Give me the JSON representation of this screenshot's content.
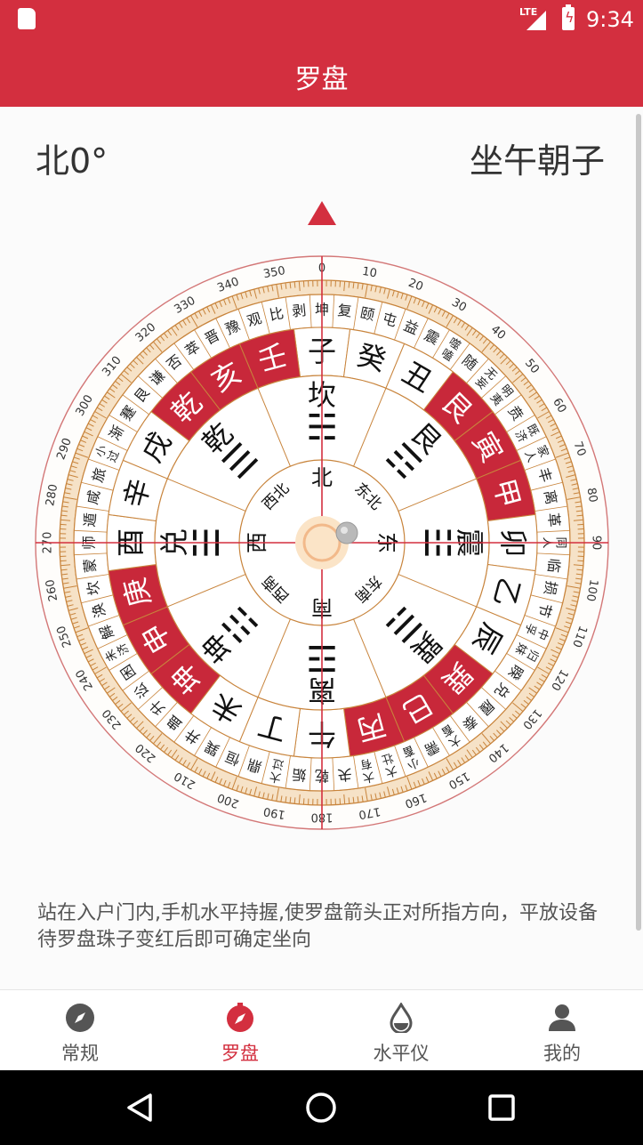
{
  "status": {
    "time": "9:34",
    "network": "LTE"
  },
  "app": {
    "title": "罗盘"
  },
  "header": {
    "heading": "北0°",
    "sitting": "坐午朝子"
  },
  "compass": {
    "ring1": [
      "北",
      "东北",
      "东",
      "东南",
      "南",
      "西南",
      "西",
      "西北"
    ],
    "ring2": [
      "☵",
      "☶",
      "☳",
      "☴",
      "☲",
      "☷",
      "☱",
      "☰"
    ],
    "ring3": [
      "坎",
      "艮",
      "震",
      "巽",
      "离",
      "坤",
      "兑",
      "乾"
    ],
    "ring4": [
      "子",
      "癸",
      "丑",
      "艮",
      "寅",
      "甲",
      "卯",
      "乙",
      "辰",
      "巽",
      "巳",
      "丙",
      "午",
      "丁",
      "未",
      "坤",
      "申",
      "庚",
      "酉",
      "辛",
      "戌",
      "乾",
      "亥",
      "壬"
    ],
    "ring4_red": [
      3,
      4,
      5,
      9,
      10,
      11,
      15,
      16,
      17,
      21,
      22,
      23
    ],
    "ring5": [
      "坤",
      "复",
      "颐",
      "屯",
      "益",
      "震",
      "噬嗑",
      "随",
      "无妄",
      "明夷",
      "贲",
      "既济",
      "家人",
      "丰",
      "离",
      "革",
      "同人",
      "临",
      "损",
      "节",
      "中孚",
      "归妹",
      "睽",
      "兑",
      "履",
      "泰",
      "大畜",
      "需",
      "小畜",
      "大壮",
      "大有",
      "夬",
      "乾",
      "姤",
      "大过",
      "鼎",
      "恒",
      "巽",
      "井",
      "蛊",
      "升",
      "讼",
      "困",
      "未济",
      "解",
      "涣",
      "坎",
      "蒙",
      "师",
      "遁",
      "咸",
      "旅",
      "小过",
      "渐",
      "蹇",
      "艮",
      "谦",
      "否",
      "萃",
      "晋",
      "豫",
      "观",
      "比",
      "剥"
    ],
    "degrees": [
      "0",
      "10",
      "20",
      "30",
      "40",
      "50",
      "60",
      "70",
      "80",
      "90",
      "100",
      "110",
      "120",
      "130",
      "140",
      "150",
      "160",
      "170",
      "180",
      "190",
      "200",
      "210",
      "220",
      "230",
      "240",
      "250",
      "260",
      "270",
      "280",
      "290",
      "300",
      "310",
      "320",
      "330",
      "340",
      "350"
    ]
  },
  "instruction": "站在入户门内,手机水平持握,使罗盘箭头正对所指方向，平放设备待罗盘珠子变红后即可确定坐向",
  "tabs": [
    {
      "label": "常规",
      "icon": "compass-icon",
      "active": false
    },
    {
      "label": "罗盘",
      "icon": "luopan-icon",
      "active": true
    },
    {
      "label": "水平仪",
      "icon": "level-drop-icon",
      "active": false
    },
    {
      "label": "我的",
      "icon": "user-icon",
      "active": false
    }
  ],
  "colors": {
    "primary": "#d32f3f",
    "ring_line": "#c8843c",
    "ring_fill": "#f6e2c7",
    "red_cell": "#c8283a"
  }
}
